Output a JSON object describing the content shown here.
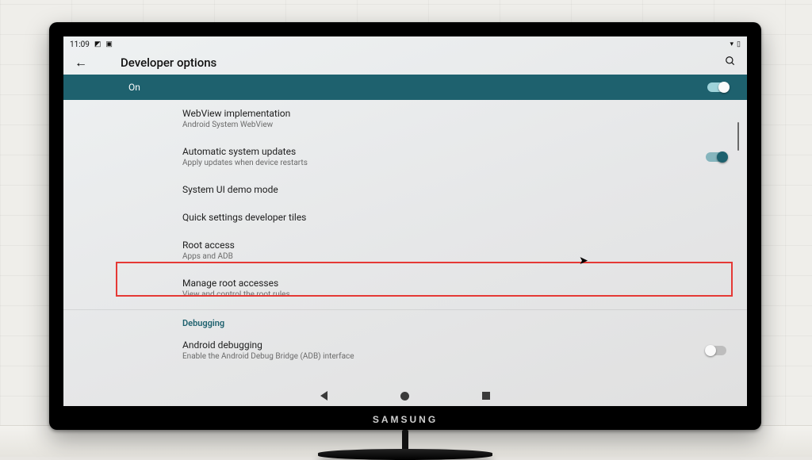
{
  "status_bar": {
    "time": "11:09"
  },
  "action_bar": {
    "title": "Developer options"
  },
  "master_toggle": {
    "label": "On",
    "state": "on"
  },
  "rows": {
    "webview": {
      "title": "WebView implementation",
      "subtitle": "Android System WebView"
    },
    "updates": {
      "title": "Automatic system updates",
      "subtitle": "Apply updates when device restarts",
      "switch": "on"
    },
    "demomode": {
      "title": "System UI demo mode"
    },
    "qs_tiles": {
      "title": "Quick settings developer tiles"
    },
    "root": {
      "title": "Root access",
      "subtitle": "Apps and ADB"
    },
    "manage_root": {
      "title": "Manage root accesses",
      "subtitle": "View and control the root rules"
    },
    "section_debug": "Debugging",
    "adb": {
      "title": "Android debugging",
      "subtitle": "Enable the Android Debug Bridge (ADB) interface",
      "switch": "off"
    }
  },
  "brand": "SAMSUNG",
  "colors": {
    "accent": "#1e616e",
    "highlight": "#e53935"
  }
}
